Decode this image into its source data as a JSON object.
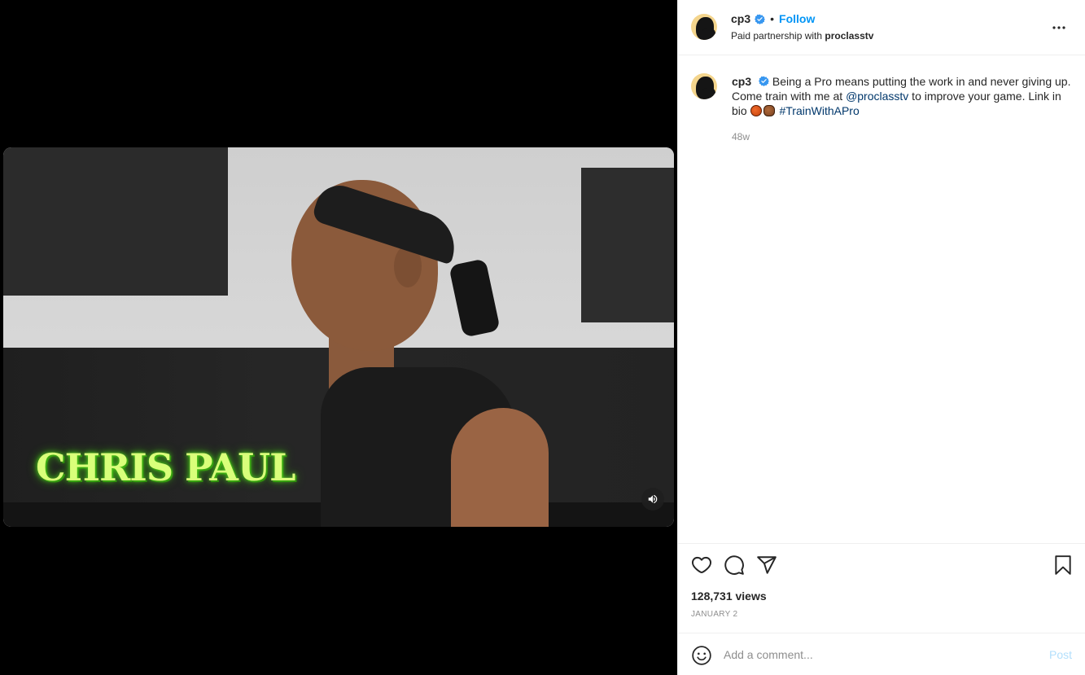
{
  "media": {
    "overlay_text": "CHRIS PAUL",
    "mute_icon": "speaker-icon"
  },
  "header": {
    "username": "cp3",
    "dot": "•",
    "follow_label": "Follow",
    "partnership_prefix": "Paid partnership with ",
    "partner_name": "proclasstv",
    "more_icon": "more-options-icon"
  },
  "caption": {
    "username": "cp3",
    "text_1": "Being a Pro means putting the work in and never giving up. Come train with me at ",
    "mention": "@proclasstv",
    "text_2": " to improve your game. Link in bio ",
    "hashtag": "#TrainWithAPro",
    "emojis": [
      "basketball-emoji",
      "basketball-emoji"
    ],
    "timestamp": "48w"
  },
  "actions": {
    "icons": [
      "heart-icon",
      "comment-icon",
      "share-icon",
      "bookmark-icon"
    ],
    "views": "128,731 views",
    "date": "JANUARY 2"
  },
  "comment_box": {
    "placeholder": "Add a comment...",
    "post_label": "Post"
  },
  "colors": {
    "accent": "#0095f6",
    "link": "#00376b",
    "muted": "#8e8e8e",
    "post_disabled": "#b2dffc",
    "caption_glow": "#4fd21c"
  }
}
